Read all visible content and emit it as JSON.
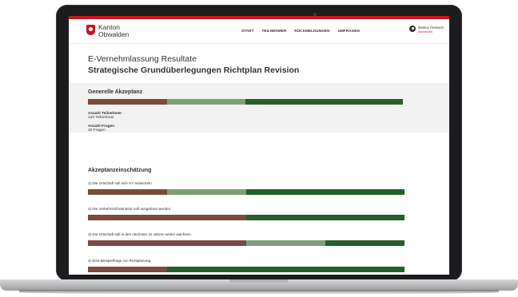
{
  "brand": {
    "line1": "Kanton",
    "line2": "Obwalden"
  },
  "nav": {
    "items": [
      "START",
      "TEILNEHMER",
      "RÜCKMELDUNGEN",
      "UMFRAGEN"
    ]
  },
  "user": {
    "name": "Markus Fleimann",
    "logout": "Abmelden"
  },
  "page": {
    "title": "E-Vernehmlassung Resultate",
    "subtitle": "Strategische Grundüberlegungen Richtplan Revision"
  },
  "general": {
    "heading": "Generelle Akzeptanz",
    "distribution": [
      0.25,
      0.25,
      0.5
    ],
    "stats": [
      {
        "label": "Anzahl Teilnehmer",
        "value": "120 Teilnehmer"
      },
      {
        "label": "Anzahl Fragen",
        "value": "10 Fragen"
      }
    ]
  },
  "assessment": {
    "heading": "Akzeptanzeinschätzung",
    "questions": [
      {
        "text": "1) Die Ortschaft soll sich XY entwickeln.",
        "distribution": [
          0.25,
          0.25,
          0.5
        ]
      },
      {
        "text": "2) Die Verkehrsinfrastruktur soll ausgebaut werden.",
        "distribution": [
          0.5,
          0.0,
          0.5
        ]
      },
      {
        "text": "3) Die Ortschaft soll in den nächsten 10 Jahren weiter wachsen.",
        "distribution": [
          0.5,
          0.25,
          0.25
        ]
      },
      {
        "text": "4) Eine Beispielfrage zur Richtplanung.",
        "distribution": [
          0.25,
          0.0,
          0.75
        ]
      }
    ]
  },
  "colors": {
    "brand": "#c8181d",
    "reject": "#7a4b3c",
    "neutral": "#7da076",
    "accept": "#275e2a"
  }
}
